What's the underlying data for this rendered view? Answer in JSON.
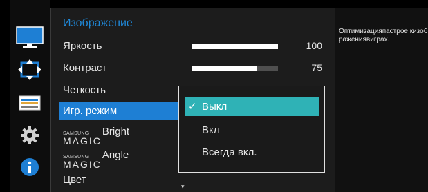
{
  "colors": {
    "accent": "#1e7fd4",
    "title": "#1f88d8",
    "option_highlight": "#2fb2b6",
    "panel": "#1c1c1c"
  },
  "sidebar": {
    "icons": [
      {
        "name": "monitor-icon",
        "selected": true
      },
      {
        "name": "screen-resize-icon",
        "selected": false
      },
      {
        "name": "pip-layout-icon",
        "selected": false
      },
      {
        "name": "gear-icon",
        "selected": false
      },
      {
        "name": "info-icon",
        "selected": false
      }
    ]
  },
  "menu": {
    "title": "Изображение",
    "items": {
      "brightness": {
        "label": "Яркость",
        "value": "100",
        "level": 1.0
      },
      "contrast": {
        "label": "Контраст",
        "value": "75",
        "level": 0.75
      },
      "sharpness": {
        "label": "Четкость"
      },
      "game_mode": {
        "label": "Игр. режим"
      },
      "magic_bright": {
        "samsung": "SAMSUNG",
        "magic": "MAGIC",
        "word": "Bright"
      },
      "magic_angle": {
        "samsung": "SAMSUNG",
        "magic": "MAGIC",
        "word": "Angle"
      },
      "color": {
        "label": "Цвет"
      }
    },
    "more_arrow": "▾"
  },
  "dropdown": {
    "options": [
      {
        "label": "Выкл",
        "selected": true,
        "check": "✓"
      },
      {
        "label": "Вкл",
        "selected": false
      },
      {
        "label": "Всегда вкл.",
        "selected": false
      }
    ]
  },
  "help": {
    "text": "Оптимизацияпастрое кизображениявиграх."
  }
}
